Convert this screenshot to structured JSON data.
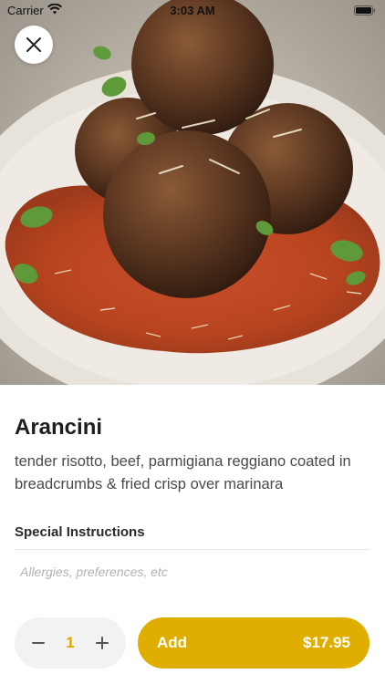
{
  "status_bar": {
    "carrier": "Carrier",
    "time": "3:03 AM"
  },
  "hero": {
    "image": "arancini-photo"
  },
  "item": {
    "title": "Arancini",
    "description": "tender risotto, beef, parmigiana reggiano coated in breadcrumbs & fried crisp over marinara"
  },
  "special_instructions": {
    "label": "Special Instructions",
    "placeholder": "Allergies, preferences, etc",
    "value": ""
  },
  "order": {
    "quantity": "1",
    "add_label": "Add",
    "price": "$17.95"
  },
  "colors": {
    "accent": "#e0ae00",
    "quantity_text": "#d9a600",
    "stepper_bg": "#f2f2f2"
  },
  "icons": {
    "close": "close-icon",
    "minus": "minus-icon",
    "plus": "plus-icon",
    "wifi": "wifi-icon",
    "battery": "battery-icon"
  }
}
